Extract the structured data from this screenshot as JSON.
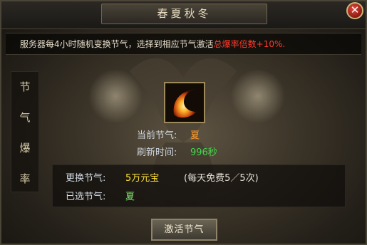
{
  "window": {
    "title": "春夏秋冬"
  },
  "info": {
    "text": "服务器每4小时随机变换节气，选择到相应节气激活",
    "highlight": "总爆率倍数+10%."
  },
  "sidebar": {
    "chars": [
      "节",
      "气",
      "爆",
      "率"
    ]
  },
  "season": {
    "icon": "sun-crescent-icon",
    "current_label": "当前节气:",
    "current_value": "夏",
    "refresh_label": "刷新时间:",
    "refresh_value": "996秒"
  },
  "cost": {
    "change_label": "更换节气:",
    "change_value": "5万元宝",
    "free_note": "(每天免费5／5次)",
    "selected_label": "已选节气:",
    "selected_value": "夏"
  },
  "activate": {
    "label": "激活节气"
  },
  "colors": {
    "highlight_red": "#ff3a2c",
    "season_orange": "#ff9a2a",
    "refresh_green": "#3fdc4a",
    "cost_yellow": "#ffe23a",
    "selected_green": "#7fe06a"
  }
}
